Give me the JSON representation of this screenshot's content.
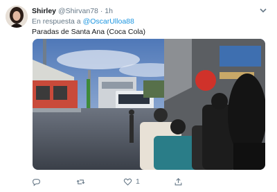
{
  "tweet": {
    "display_name": "Shirley",
    "handle": "@Shirvan78",
    "separator": "·",
    "time": "1h",
    "reply_prefix": "En respuesta a",
    "reply_to": "@OscarUlloa88",
    "text": "Paradas de Santa Ana (Coca Cola)"
  },
  "actions": {
    "reply": {
      "icon": "reply-icon",
      "count": ""
    },
    "retweet": {
      "icon": "retweet-icon",
      "count": ""
    },
    "like": {
      "icon": "heart-icon",
      "count": "1"
    },
    "share": {
      "icon": "share-icon",
      "count": ""
    }
  },
  "colors": {
    "link": "#1b95e0",
    "muted": "#657786",
    "text": "#14171a"
  }
}
